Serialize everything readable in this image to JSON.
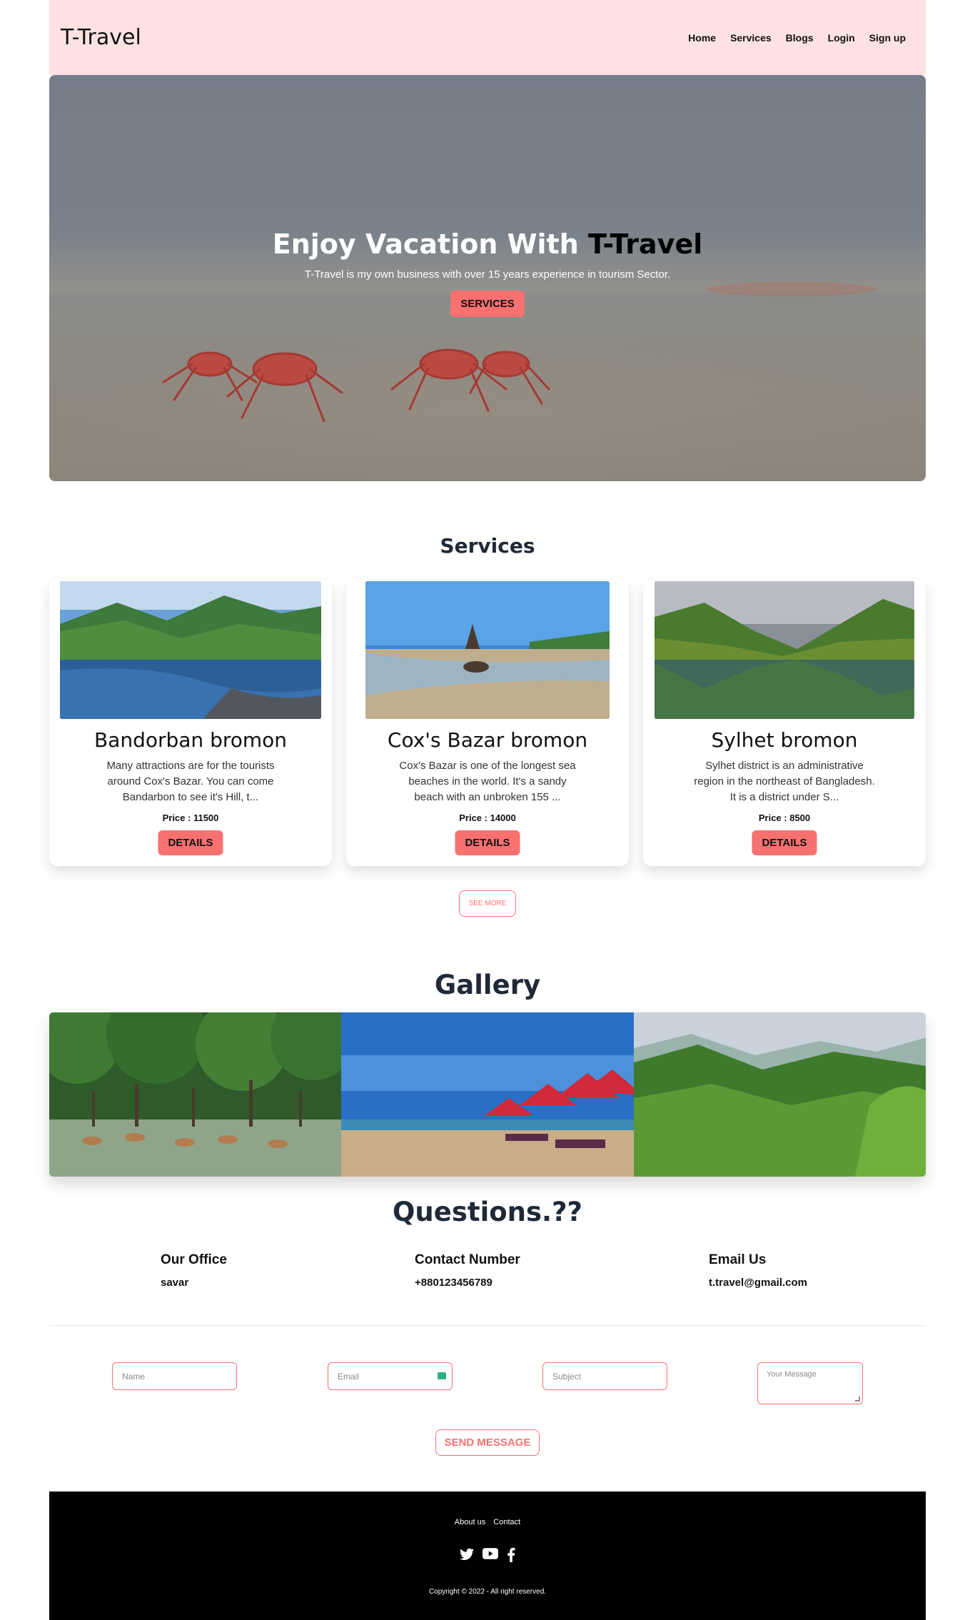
{
  "brand": "T-Travel",
  "nav": [
    "Home",
    "Services",
    "Blogs",
    "Login",
    "Sign up"
  ],
  "hero": {
    "title_main": "Enjoy Vacation With ",
    "title_accent": "T-Travel",
    "subtitle": "T-Travel is my own business with over 15 years experience in tourism Sector.",
    "button": "SERVICES"
  },
  "services": {
    "heading": "Services",
    "items": [
      {
        "title": "Bandorban bromon",
        "description": "Many attractions are for the tourists around Cox's Bazar. You can come Bandarbon to see it's Hill, t...",
        "price": "Price : 11500",
        "button": "DETAILS",
        "image": "river-hills-landscape"
      },
      {
        "title": "Cox's Bazar bromon",
        "description": "Cox's Bazar is one of the longest sea beaches in the world. It's a sandy beach with an unbroken 155 ...",
        "price": "Price : 14000",
        "button": "DETAILS",
        "image": "beach-boat-landscape"
      },
      {
        "title": "Sylhet bromon",
        "description": "Sylhet district is an administrative region in the northeast of Bangladesh. It is a district under S...",
        "price": "Price : 8500",
        "button": "DETAILS",
        "image": "lake-mountain-landscape"
      }
    ],
    "see_more": "SEE MORE"
  },
  "gallery": {
    "heading": "Gallery",
    "images": [
      "mangrove-deer-photo",
      "beach-umbrellas-photo",
      "green-hills-photo"
    ]
  },
  "contact": {
    "heading": "Questions.??",
    "office_label": "Our Office",
    "office_value": "savar",
    "phone_label": "Contact Number",
    "phone_value": "+880123456789",
    "email_label": "Email Us",
    "email_value": "t.travel@gmail.com",
    "form": {
      "name_placeholder": "Name",
      "email_placeholder": "Email",
      "subject_placeholder": "Subject",
      "message_placeholder": "Your Message",
      "send": "SEND MESSAGE"
    }
  },
  "footer": {
    "links": [
      "About us",
      "Contact"
    ],
    "social": [
      "twitter-icon",
      "youtube-icon",
      "facebook-icon"
    ],
    "copyright": "Copyright © 2022 - All right reserved."
  },
  "colors": {
    "nav_bg": "#fee2e2",
    "accent": "#f87171",
    "footer_bg": "#000000"
  }
}
